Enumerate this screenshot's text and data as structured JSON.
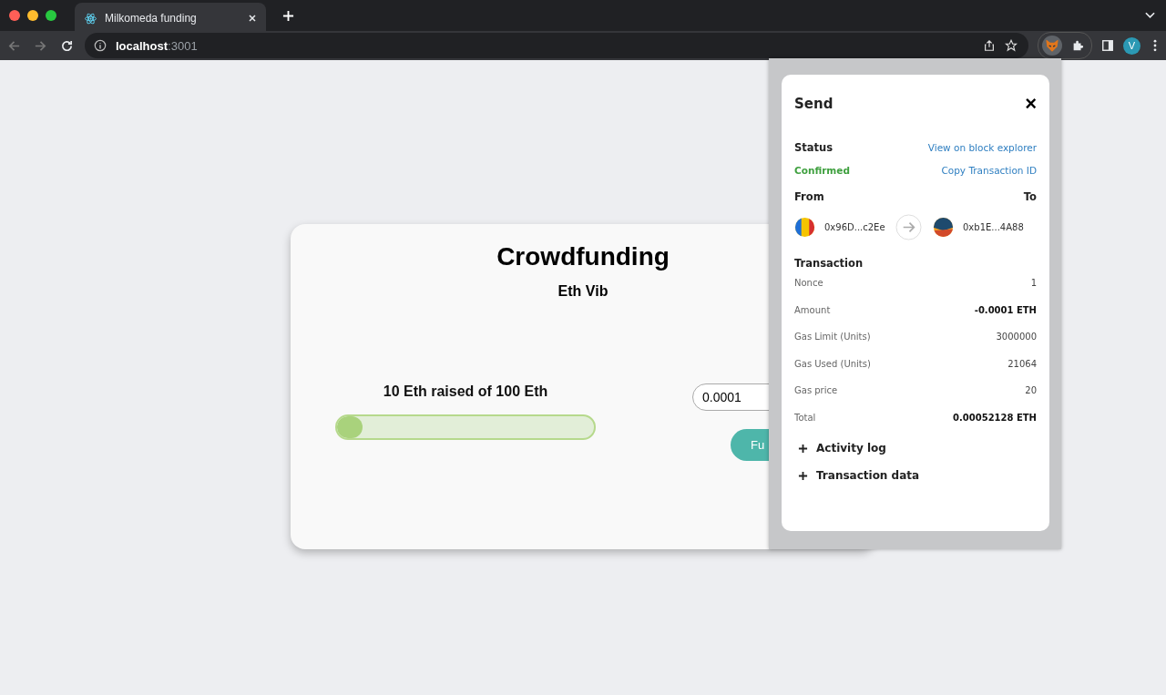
{
  "browser": {
    "tab": {
      "title": "Milkomeda funding",
      "selected": true
    },
    "address": {
      "host": "localhost",
      "port": ":3001"
    },
    "profile_initial": "V"
  },
  "campaign": {
    "title": "Crowdfunding",
    "subtitle": "Eth Vib",
    "progress_label": "10 Eth raised of 100 Eth",
    "level": 0.1,
    "amount_value": "0.0001",
    "fund_button": "Fu"
  },
  "wallet_popup": {
    "title": "Send",
    "close": "×",
    "status_label": "Status",
    "status": "Confirmed",
    "view_link": "View on block explorer",
    "copy_link": "Copy Transaction ID",
    "from_label": "From",
    "to_label": "To",
    "from_address": "0x96D...c2Ee",
    "to_address": "0xb1E...4A88",
    "transaction_heading": "Transaction",
    "rows": [
      {
        "label": "Nonce",
        "value": "1",
        "bold": false
      },
      {
        "label": "Amount",
        "value": "-0.0001 ETH",
        "bold": true
      },
      {
        "label": "Gas Limit (Units)",
        "value": "3000000",
        "bold": false
      },
      {
        "label": "Gas Used (Units)",
        "value": "21064",
        "bold": false
      },
      {
        "label": "Gas price",
        "value": "20",
        "bold": false
      },
      {
        "label": "Total",
        "value": "0.00052128 ETH",
        "bold": true
      }
    ],
    "sections": [
      {
        "label": "Activity log",
        "expanded": false
      },
      {
        "label": "Transaction data",
        "expanded": false
      }
    ]
  }
}
